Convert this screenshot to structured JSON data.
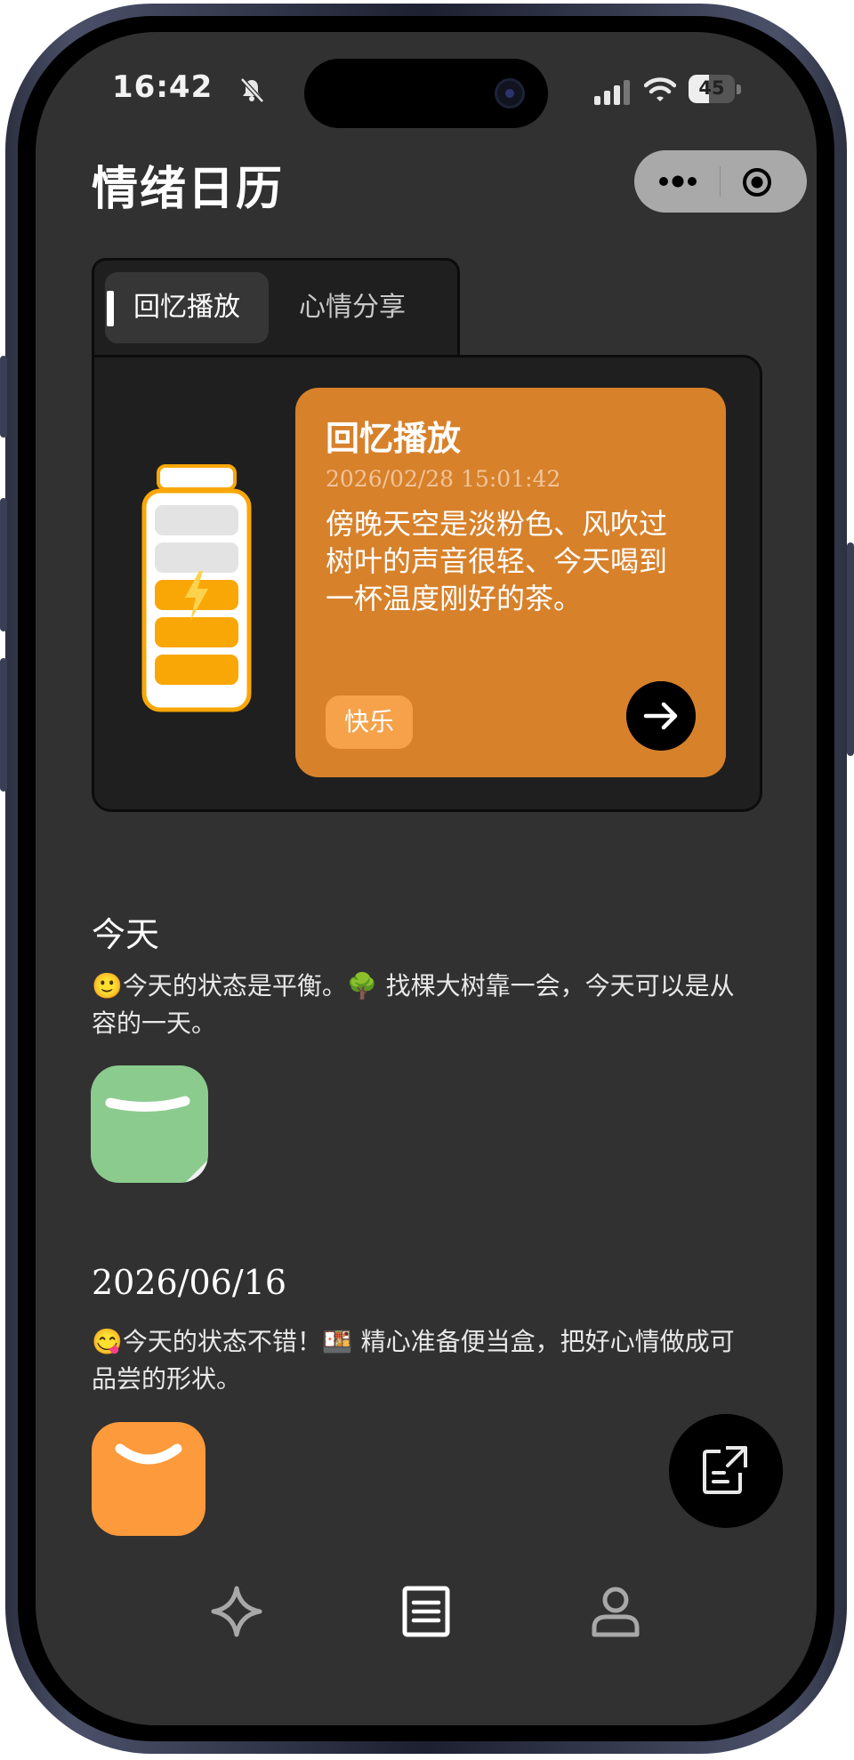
{
  "status_bar": {
    "time": "16:42",
    "battery": "45",
    "battery_level": 0.45
  },
  "header": {
    "title": "情绪日历"
  },
  "tabs": [
    {
      "label": "回忆播放",
      "active": true
    },
    {
      "label": "心情分享",
      "active": false
    }
  ],
  "memory": {
    "title": "回忆播放",
    "date": "2026/02/28 15:01:42",
    "text": "傍晚天空是淡粉色、风吹过树叶的声音很轻、今天喝到一杯温度刚好的茶。",
    "mood": "快乐"
  },
  "entries": [
    {
      "date": "今天",
      "text": "🙂今天的状态是平衡。🌳 找棵大树靠一会，今天可以是从容的一天。",
      "mood_icon": "green-smile-icon"
    },
    {
      "date": "2026/06/16",
      "text": "😋今天的状态不错！🍱 精心准备便当盒，把好心情做成可品尝的形状。",
      "mood_icon": "orange-smile-icon"
    }
  ],
  "nav": [
    {
      "icon": "sparkle-icon",
      "active": false
    },
    {
      "icon": "diary-list-icon",
      "active": true
    },
    {
      "icon": "profile-icon",
      "active": false
    }
  ],
  "colors": {
    "background": "#313131",
    "card": "#1f1f1f",
    "memory_card": "#d7812b",
    "mood_tag": "#f5a24b",
    "mood_green": "#8ccb8e",
    "mood_orange": "#fd9a3b",
    "battery_yellow": "#f9a707"
  }
}
